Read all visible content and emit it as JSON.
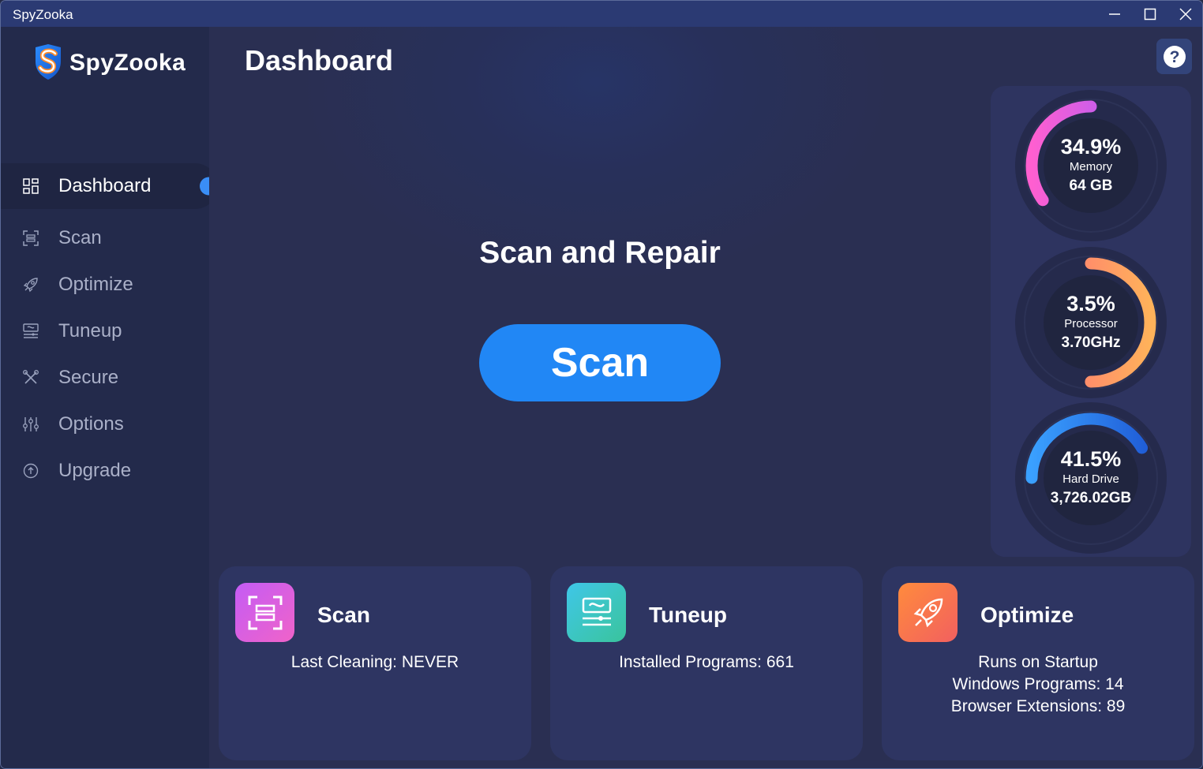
{
  "window": {
    "title": "SpyZooka"
  },
  "brand": {
    "name": "SpyZooka"
  },
  "header": {
    "title": "Dashboard",
    "help_label": "?"
  },
  "sidebar": {
    "items": [
      {
        "label": "Dashboard",
        "icon": "dashboard-icon",
        "active": true
      },
      {
        "label": "Scan",
        "icon": "scan-icon"
      },
      {
        "label": "Optimize",
        "icon": "rocket-icon"
      },
      {
        "label": "Tuneup",
        "icon": "tuneup-icon"
      },
      {
        "label": "Secure",
        "icon": "tools-icon"
      },
      {
        "label": "Options",
        "icon": "sliders-icon"
      },
      {
        "label": "Upgrade",
        "icon": "upgrade-icon"
      }
    ]
  },
  "hero": {
    "title": "Scan and Repair",
    "button_label": "Scan"
  },
  "gauges": [
    {
      "percent": "34.9%",
      "label": "Memory",
      "sub": "64 GB",
      "value": 0.349
    },
    {
      "percent": "3.5%",
      "label": "Processor",
      "sub": "3.70GHz",
      "value": 0.5
    },
    {
      "percent": "41.5%",
      "label": "Hard Drive",
      "sub": "3,726.02GB",
      "value": 0.415
    }
  ],
  "cards": [
    {
      "title": "Scan",
      "lines": [
        "Last Cleaning: NEVER"
      ]
    },
    {
      "title": "Tuneup",
      "lines": [
        "Installed Programs: 661"
      ]
    },
    {
      "title": "Optimize",
      "lines": [
        "Runs on Startup",
        "Windows Programs: 14",
        "Browser Extensions: 89"
      ]
    }
  ],
  "colors": {
    "accent": "#2187f5",
    "memory_gauge": [
      "#a35cff",
      "#ff5fd0"
    ],
    "processor_gauge": [
      "#ff6f78",
      "#ffb25a"
    ],
    "harddrive_gauge": [
      "#1f5bd6",
      "#3aa0ff"
    ]
  }
}
